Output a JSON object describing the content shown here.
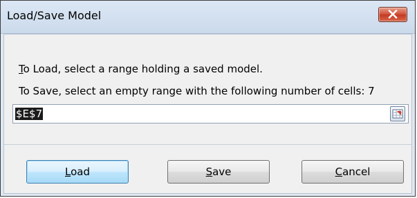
{
  "dialog": {
    "title": "Load/Save Model",
    "close_icon": "close-icon"
  },
  "instructions": {
    "load_prefix": "T",
    "load_rest": "o Load, select a range holding a saved model.",
    "save_line": "To Save, select an empty range with the following number of cells: 7"
  },
  "range_field": {
    "value": "$E$7",
    "collapse_icon": "range-collapse-icon"
  },
  "buttons": {
    "load": {
      "mnemonic": "L",
      "rest": "oad"
    },
    "save": {
      "mnemonic": "S",
      "rest": "ave"
    },
    "cancel": {
      "mnemonic": "C",
      "rest": "ancel"
    }
  },
  "colors": {
    "close_button": "#c8472f",
    "default_button_border": "#3c7fb1",
    "selection_bg": "#1b1b1b"
  }
}
